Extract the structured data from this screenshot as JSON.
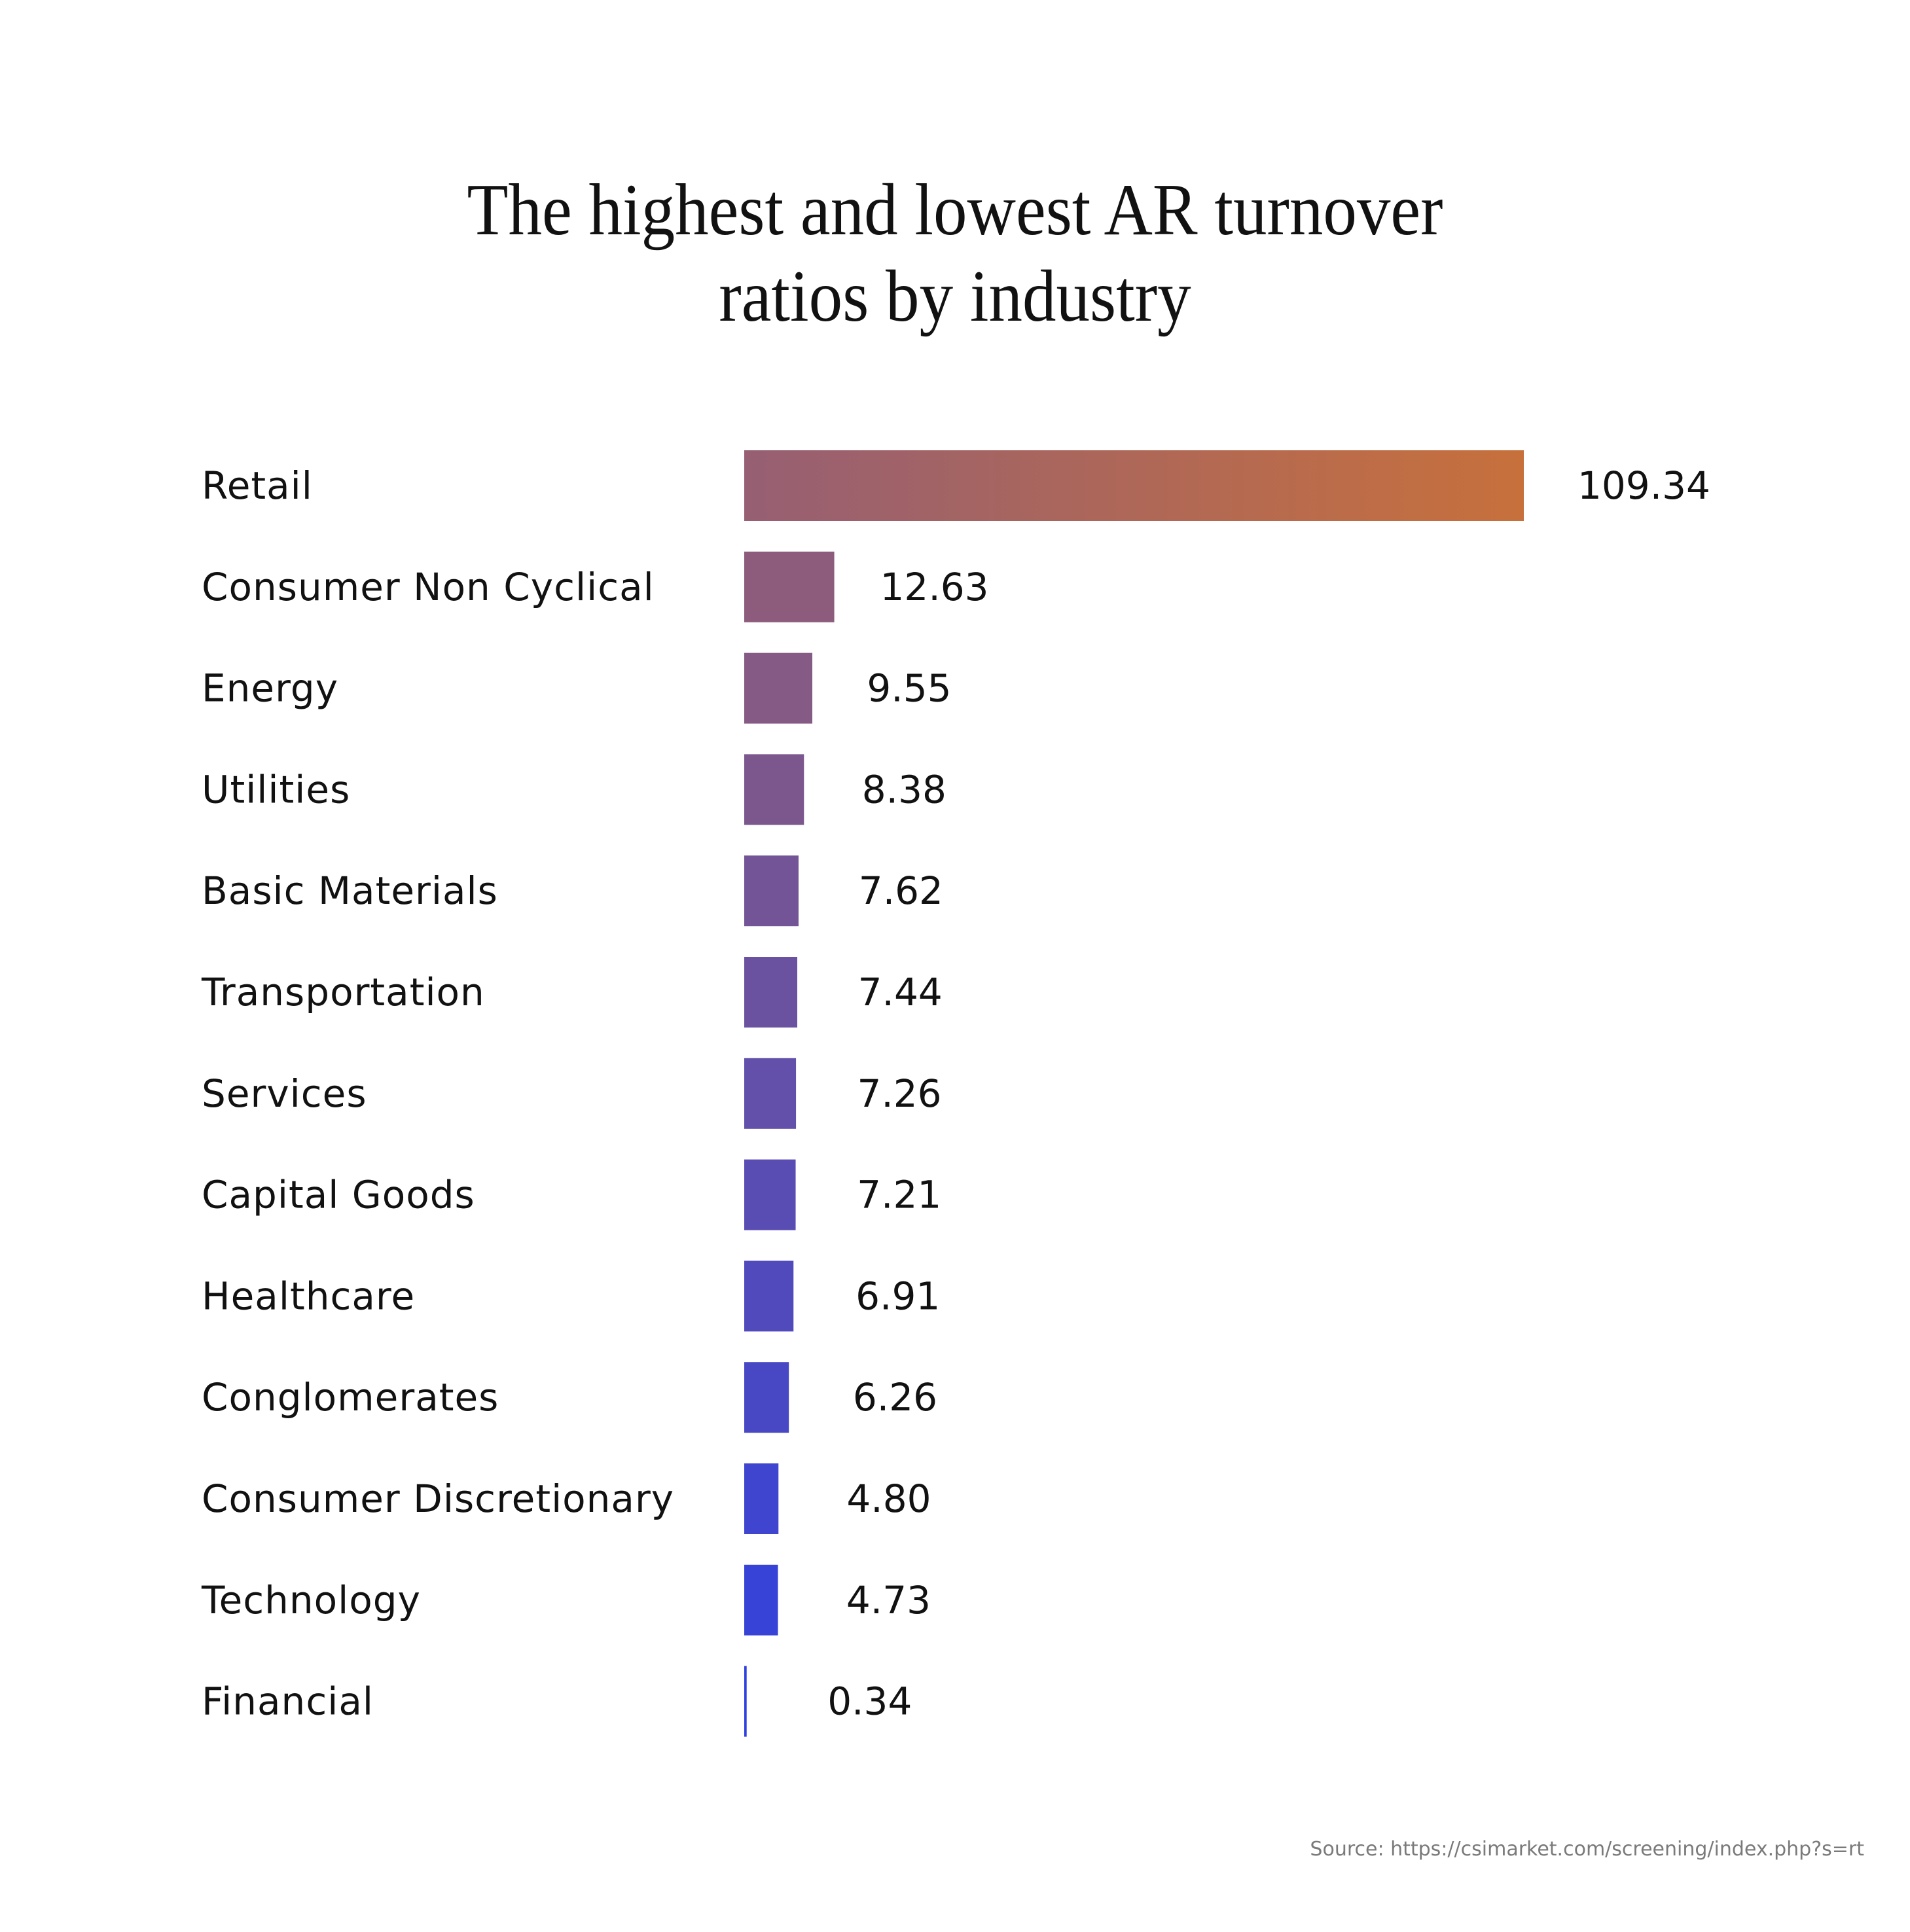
{
  "chart_data": {
    "type": "bar",
    "orientation": "horizontal",
    "title": "The highest and lowest AR turnover ratios by industry",
    "title_lines": [
      "The highest and lowest AR turnover",
      "ratios by industry"
    ],
    "xlabel": "",
    "ylabel": "",
    "categories": [
      "Retail",
      "Consumer Non Cyclical",
      "Energy",
      "Utilities",
      "Basic Materials",
      "Transportation",
      "Services",
      "Capital Goods",
      "Healthcare",
      "Conglomerates",
      "Consumer Discretionary",
      "Technology",
      "Financial"
    ],
    "values": [
      109.34,
      12.63,
      9.55,
      8.38,
      7.62,
      7.44,
      7.26,
      7.21,
      6.91,
      6.26,
      4.8,
      4.73,
      0.34
    ],
    "value_labels": [
      "109.34",
      "12.63",
      "9.55",
      "8.38",
      "7.62",
      "7.44",
      "7.26",
      "7.21",
      "6.91",
      "6.26",
      "4.80",
      "4.73",
      "0.34"
    ],
    "xlim": [
      0,
      109.34
    ],
    "grid": false,
    "legend": "none",
    "colors": {
      "gradient_top_left": "#965f73",
      "gradient_top_right": "#c7703c",
      "bottom": "#2e40e0"
    },
    "source": "Source: https://csimarket.com/screening/index.php?s=rt"
  }
}
